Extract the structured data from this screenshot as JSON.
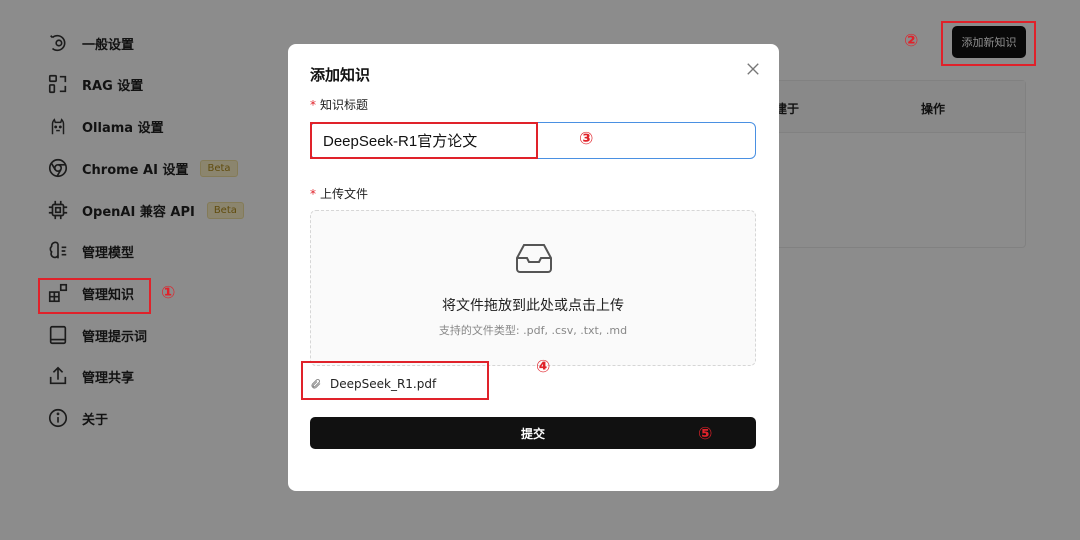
{
  "sidebar": {
    "items": [
      {
        "label": "一般设置",
        "icon": "general-settings-icon"
      },
      {
        "label": "RAG 设置",
        "icon": "rag-settings-icon"
      },
      {
        "label": "Ollama 设置",
        "icon": "ollama-icon"
      },
      {
        "label": "Chrome AI 设置",
        "icon": "chrome-icon",
        "badge": "Beta"
      },
      {
        "label": "OpenAI 兼容 API",
        "icon": "chip-icon",
        "badge": "Beta"
      },
      {
        "label": "管理模型",
        "icon": "brain-icon"
      },
      {
        "label": "管理知识",
        "icon": "blocks-icon",
        "selected": true
      },
      {
        "label": "管理提示词",
        "icon": "book-icon"
      },
      {
        "label": "管理共享",
        "icon": "share-icon"
      },
      {
        "label": "关于",
        "icon": "info-icon"
      }
    ]
  },
  "header": {
    "add_knowledge_button": "添加新知识"
  },
  "table": {
    "columns": [
      "创建于",
      "操作"
    ]
  },
  "annotations": {
    "n1": "①",
    "n2": "②",
    "n3": "③",
    "n4": "④",
    "n5": "⑤",
    "color": "#e0222a"
  },
  "modal": {
    "title": "添加知识",
    "title_field": {
      "required_mark": "*",
      "label": "知识标题",
      "value": "DeepSeek-R1官方论文"
    },
    "upload_field": {
      "required_mark": "*",
      "label": "上传文件"
    },
    "dropzone": {
      "main_text": "将文件拖放到此处或点击上传",
      "sub_text": "支持的文件类型: .pdf, .csv, .txt, .md"
    },
    "uploaded_file": "DeepSeek_R1.pdf",
    "submit_label": "提交"
  }
}
